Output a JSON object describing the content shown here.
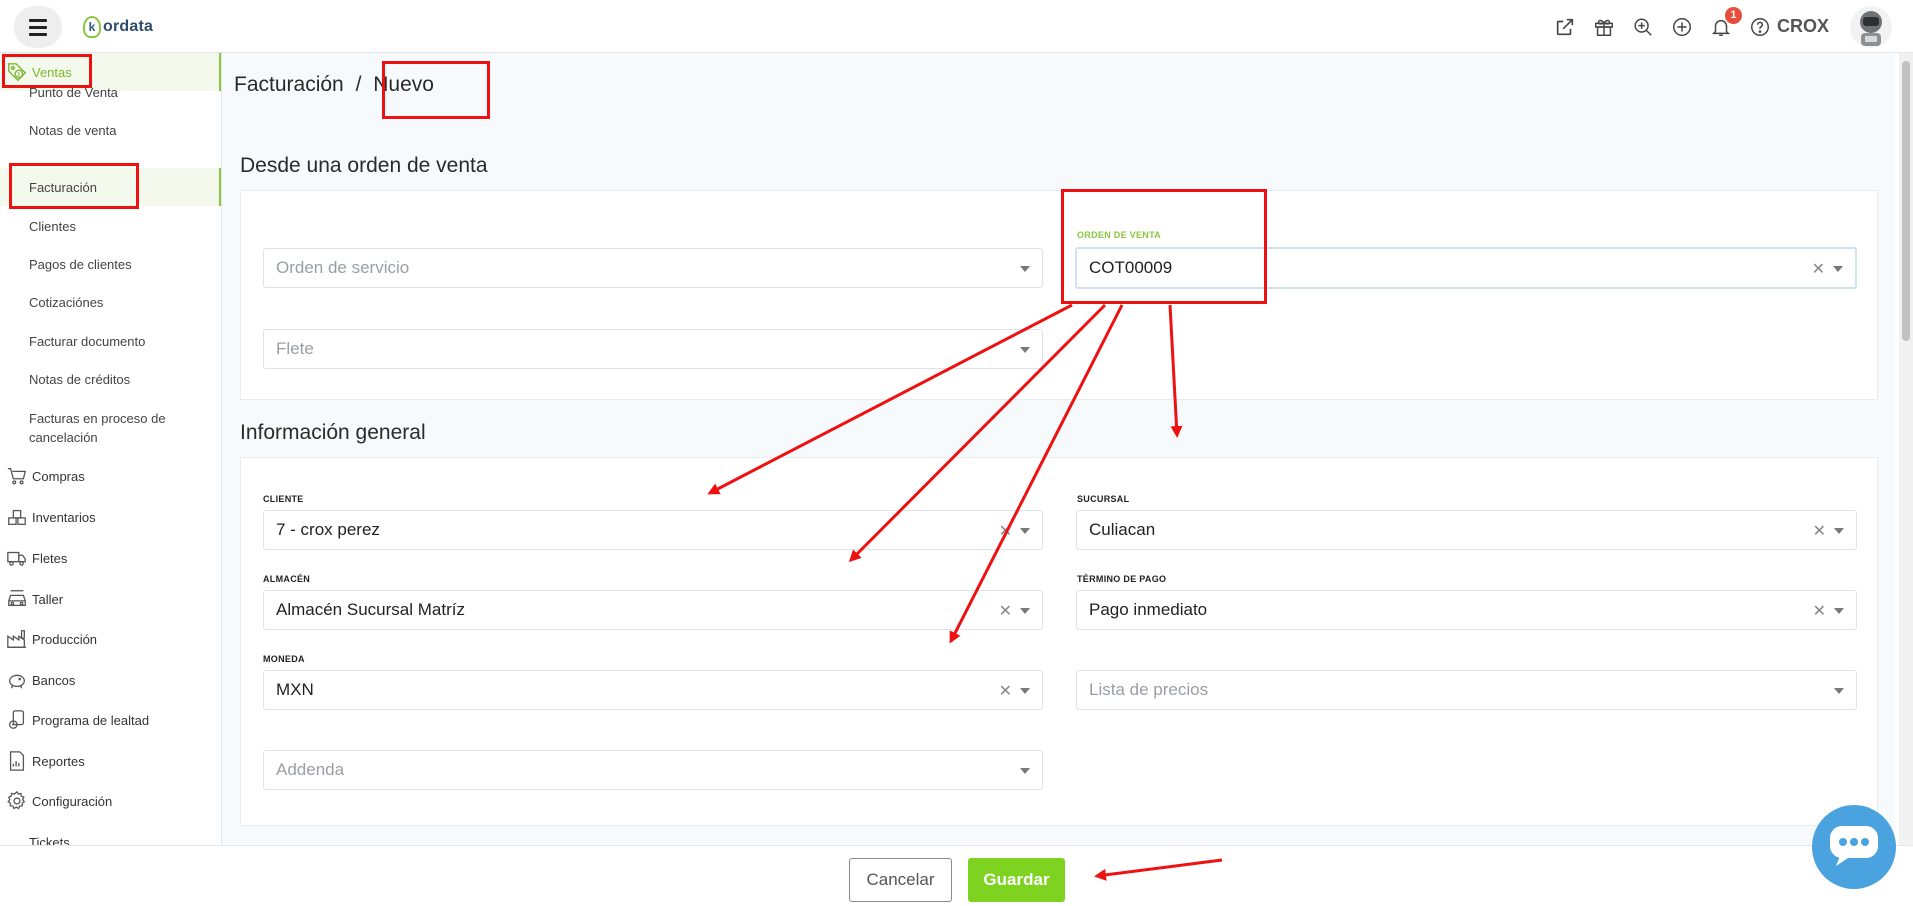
{
  "app": {
    "logo_initial": "k",
    "logo_text": "ordata",
    "user_name": "CROX",
    "notification_count": "1",
    "icons": [
      "external-link-icon",
      "gift-icon",
      "zoom-icon",
      "add-circle-icon",
      "bell-icon",
      "help-icon"
    ]
  },
  "sidebar": {
    "ventas": {
      "label": "Ventas",
      "items": [
        {
          "label": "Punto de Venta"
        },
        {
          "label": "Notas de venta"
        },
        {
          "label": "Facturación"
        },
        {
          "label": "Clientes"
        },
        {
          "label": "Pagos de clientes"
        },
        {
          "label": "Cotizaciónes"
        },
        {
          "label": "Facturar documento"
        },
        {
          "label": "Notas de créditos"
        },
        {
          "label": "Facturas en proceso de cancelación"
        }
      ],
      "active_item": "Facturación"
    },
    "sections": [
      {
        "label": "Compras",
        "icon": "cart-icon"
      },
      {
        "label": "Inventarios",
        "icon": "boxes-icon"
      },
      {
        "label": "Fletes",
        "icon": "truck-icon"
      },
      {
        "label": "Taller",
        "icon": "car-icon"
      },
      {
        "label": "Producción",
        "icon": "factory-icon"
      },
      {
        "label": "Bancos",
        "icon": "piggy-bank-icon"
      },
      {
        "label": "Programa de lealtad",
        "icon": "loyalty-icon"
      },
      {
        "label": "Reportes",
        "icon": "report-icon"
      },
      {
        "label": "Configuración",
        "icon": "gear-icon"
      },
      {
        "label": "Tickets",
        "icon": "ticket-icon"
      }
    ]
  },
  "breadcrumb": {
    "parent": "Facturación",
    "separator": "/",
    "current": "Nuevo"
  },
  "desde_orden": {
    "title": "Desde una orden de venta",
    "orden_servicio": {
      "placeholder": "Orden de servicio"
    },
    "orden_venta": {
      "label": "ORDEN DE VENTA",
      "value": "COT00009"
    },
    "flete": {
      "placeholder": "Flete"
    }
  },
  "info_general": {
    "title": "Información general",
    "cliente": {
      "label": "CLIENTE",
      "value": "7 - crox perez"
    },
    "sucursal": {
      "label": "SUCURSAL",
      "value": "Culiacan"
    },
    "almacen": {
      "label": "ALMACÉN",
      "value": "Almacén Sucursal Matríz"
    },
    "termino_pago": {
      "label": "TÉRMINO DE PAGO",
      "value": "Pago inmediato"
    },
    "moneda": {
      "label": "MONEDA",
      "value": "MXN"
    },
    "lista_precios": {
      "placeholder": "Lista de precios"
    },
    "addenda": {
      "placeholder": "Addenda"
    }
  },
  "footer": {
    "cancel_label": "Cancelar",
    "save_label": "Guardar"
  },
  "colors": {
    "accent": "#8cc63f",
    "save_button": "#7ed321",
    "annotation": "#ee1111",
    "chat_fab": "#4aa3df"
  }
}
